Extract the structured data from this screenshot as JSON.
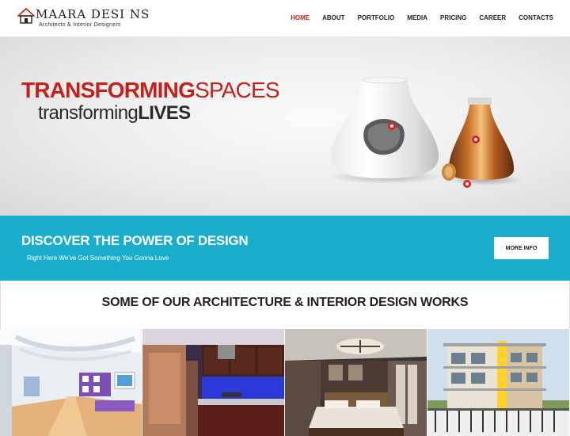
{
  "brand": {
    "name": "MAARA DESI NS",
    "tagline": "Architects & Interior Designers"
  },
  "nav": {
    "items": [
      {
        "label": "HOME",
        "active": true
      },
      {
        "label": "ABOUT",
        "active": false
      },
      {
        "label": "PORTFOLIO",
        "active": false
      },
      {
        "label": "MEDIA",
        "active": false
      },
      {
        "label": "PRICING",
        "active": false
      },
      {
        "label": "CAREER",
        "active": false
      },
      {
        "label": "CONTACTS",
        "active": false
      }
    ]
  },
  "hero": {
    "line1_bold": "TRANSFORMING",
    "line1_light": "SPACES",
    "line2_light": "transforming",
    "line2_bold": "LIVES"
  },
  "banner": {
    "title": "DISCOVER THE POWER OF DESIGN",
    "subtitle": "Right Here We've Got Something You Gonna Love",
    "button_label": "MORE INFO"
  },
  "works": {
    "title": "SOME OF OUR ARCHITECTURE & INTERIOR DESIGN WORKS"
  },
  "colors": {
    "accent": "#c3211c",
    "banner": "#1aaecc",
    "text": "#222222"
  },
  "gallery": {
    "items": [
      {
        "name": "office-interior-render"
      },
      {
        "name": "kitchen-interior-render"
      },
      {
        "name": "bedroom-interior-render"
      },
      {
        "name": "building-exterior-render"
      }
    ]
  }
}
